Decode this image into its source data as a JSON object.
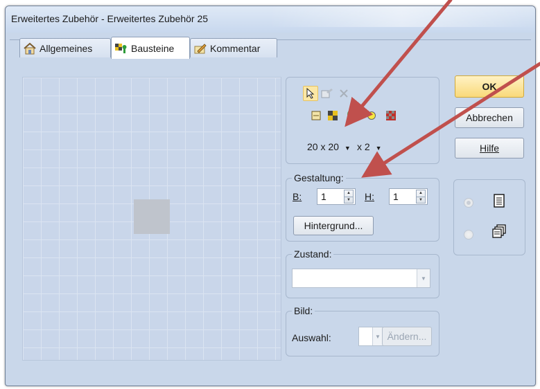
{
  "window": {
    "title": "Erweitertes Zubehör - Erweitertes Zubehör 25"
  },
  "tabs": [
    {
      "label": "Allgemeines",
      "icon": "house-icon",
      "active": false
    },
    {
      "label": "Bausteine",
      "icon": "blocks-icon",
      "active": true
    },
    {
      "label": "Kommentar",
      "icon": "pencil-note-icon",
      "active": false
    }
  ],
  "tools": {
    "row1": [
      "pointer-icon",
      "properties-icon",
      "delete-icon"
    ],
    "row2": [
      "frame-icon",
      "tile-icon",
      "signal-icon",
      "circle-icon",
      "red-block-icon"
    ],
    "grid_size": "20 x 20",
    "zoom": "x 2"
  },
  "gestaltung": {
    "legend": "Gestaltung:",
    "b_label": "B",
    "b_value": "1",
    "h_label": "H",
    "h_value": "1",
    "background_button": "Hintergrund..."
  },
  "zustand": {
    "legend": "Zustand:",
    "value": ""
  },
  "bild": {
    "legend": "Bild:",
    "auswahl_label": "Auswahl:",
    "aendern_button": "Ändern..."
  },
  "buttons": {
    "ok": "OK",
    "cancel": "Abbrechen",
    "help": "Hilfe"
  },
  "view_options": [
    {
      "icon": "list-view-icon",
      "checked": true
    },
    {
      "icon": "stacked-view-icon",
      "checked": false
    }
  ],
  "colors": {
    "window_bg": "#c9d7ea",
    "ok_button": "#f9d97a",
    "annotation_arrow": "#c0504d"
  }
}
